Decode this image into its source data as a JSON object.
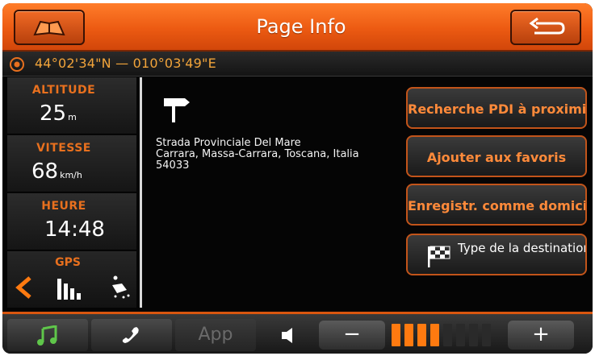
{
  "header": {
    "title": "Page Info",
    "left_button_icon": "map-book-icon",
    "right_button_icon": "back-arrow-icon"
  },
  "coordinates": {
    "text": "44°02'34\"N — 010°03'49\"E",
    "icon": "gps-target-icon"
  },
  "left_panel": {
    "altitude": {
      "label": "ALTITUDE",
      "value": "25",
      "unit": "m"
    },
    "speed": {
      "label": "VITESSE",
      "value": "68",
      "unit": "km/h"
    },
    "time": {
      "label": "HEURE",
      "value": "14:48"
    },
    "gps": {
      "label": "GPS",
      "icons": [
        "arrow-left-icon",
        "signal-bars-icon",
        "satellite-icon"
      ]
    }
  },
  "address": {
    "icon": "signpost-icon",
    "line1": "Strada Provinciale Del Mare",
    "line2": "Carrara, Massa-Carrara, Toscana, Italia",
    "line3": "54033"
  },
  "actions": {
    "nearby_poi": "Recherche PDI à proximité",
    "add_favorites": "Ajouter aux favoris",
    "save_home": "Enregistr. comme domicile",
    "destination_type": "Type de la destination"
  },
  "bottom_bar": {
    "music_icon": "music-note-icon",
    "phone_icon": "phone-icon",
    "app_label": "App",
    "speaker_icon": "speaker-icon",
    "volume_down": "−",
    "volume_up": "+",
    "volume_level": 4,
    "volume_max": 8
  },
  "colors": {
    "accent": "#ec5a12",
    "label_orange": "#e8701e",
    "button_text": "#ff8a3a",
    "volume_on": "#ff7a10",
    "volume_off": "#2a2a2a",
    "music_green": "#5fc64a"
  }
}
